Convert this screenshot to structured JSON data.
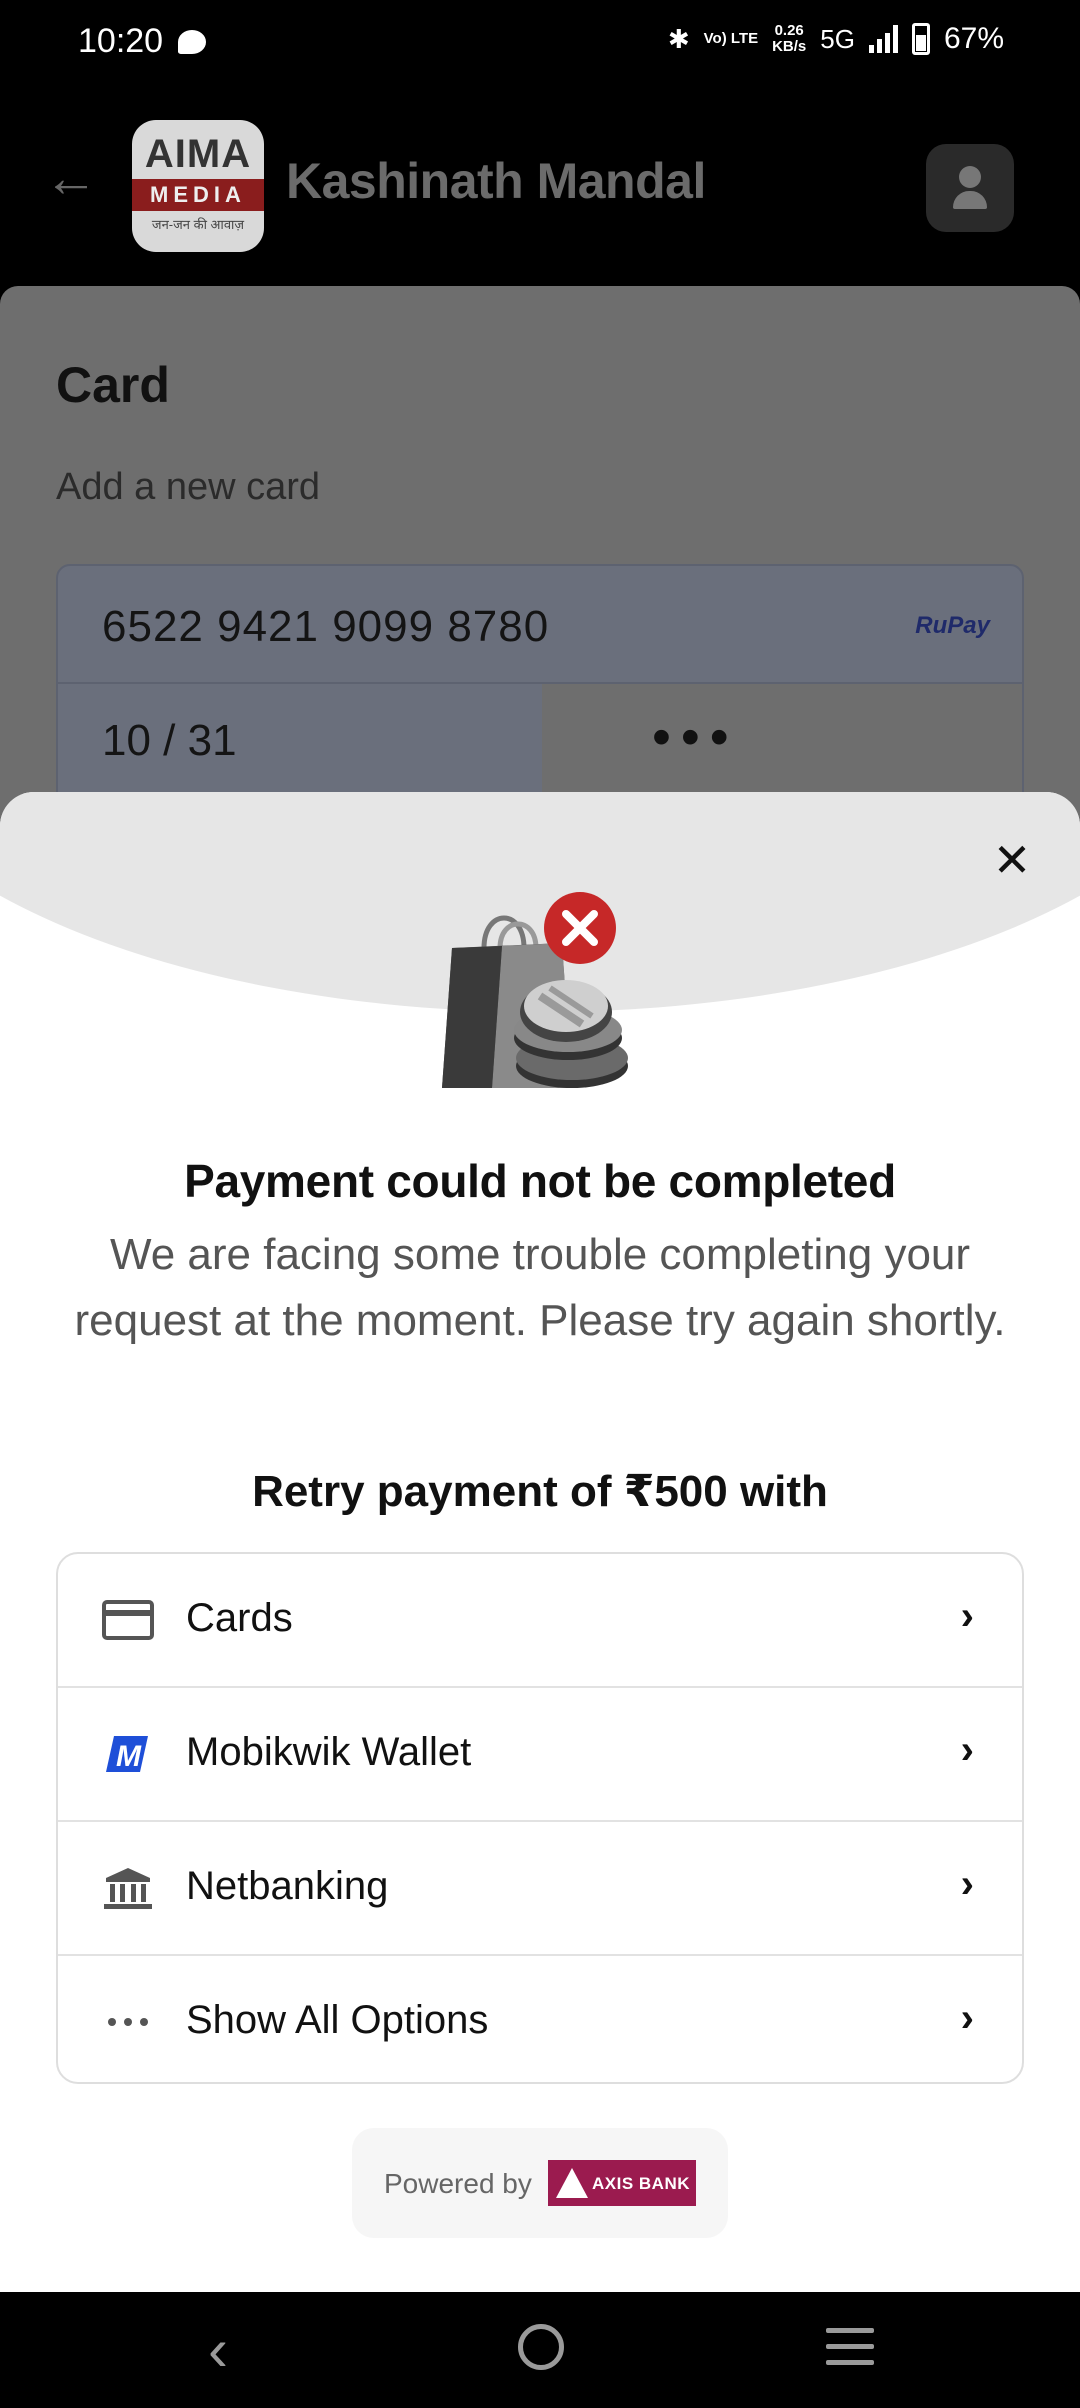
{
  "status_bar": {
    "time": "10:20",
    "lte_label": "Vo) LTE",
    "net_speed_value": "0.26",
    "net_speed_unit": "KB/s",
    "network": "5G",
    "battery": "67%"
  },
  "header": {
    "title": "Kashinath Mandal",
    "logo_top": "AIMA",
    "logo_band": "MEDIA",
    "logo_sub": "जन-जन की आवाज़"
  },
  "card_page": {
    "title": "Card",
    "subtitle": "Add a new card",
    "card_number": "6522 9421 9099 8780",
    "network": "RuPay",
    "expiry": "10 / 31",
    "cvv_mask": "•••"
  },
  "error_sheet": {
    "title": "Payment could not be completed",
    "message": "We are facing some trouble completing your request at the moment. Please try again shortly.",
    "retry_title": "Retry payment of ₹500 with",
    "options": [
      {
        "label": "Cards",
        "icon": "card-icon"
      },
      {
        "label": "Mobikwik Wallet",
        "icon": "mobikwik-icon"
      },
      {
        "label": "Netbanking",
        "icon": "bank-icon"
      },
      {
        "label": "Show All Options",
        "icon": "more-dots-icon"
      }
    ],
    "powered_by": "Powered by",
    "bank_name": "AXIS BANK"
  },
  "colors": {
    "axis_brand": "#9b1b4f",
    "error_badge": "#c62828",
    "mobikwik_blue": "#1e4fd8"
  }
}
